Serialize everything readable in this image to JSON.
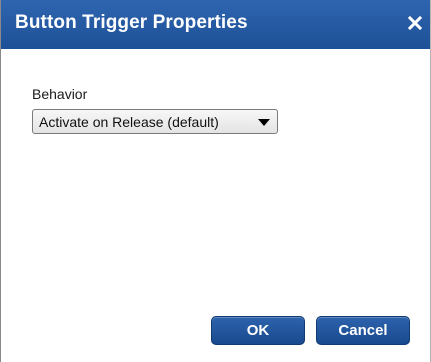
{
  "dialog": {
    "title": "Button Trigger Properties",
    "close_icon": "close-icon",
    "colors": {
      "titlebar": "#1d5096",
      "button": "#1f55a0"
    }
  },
  "behavior": {
    "label": "Behavior",
    "selected": "Activate on Release (default)",
    "arrow_icon": "dropdown-arrow-icon"
  },
  "buttons": {
    "ok": "OK",
    "cancel": "Cancel"
  }
}
